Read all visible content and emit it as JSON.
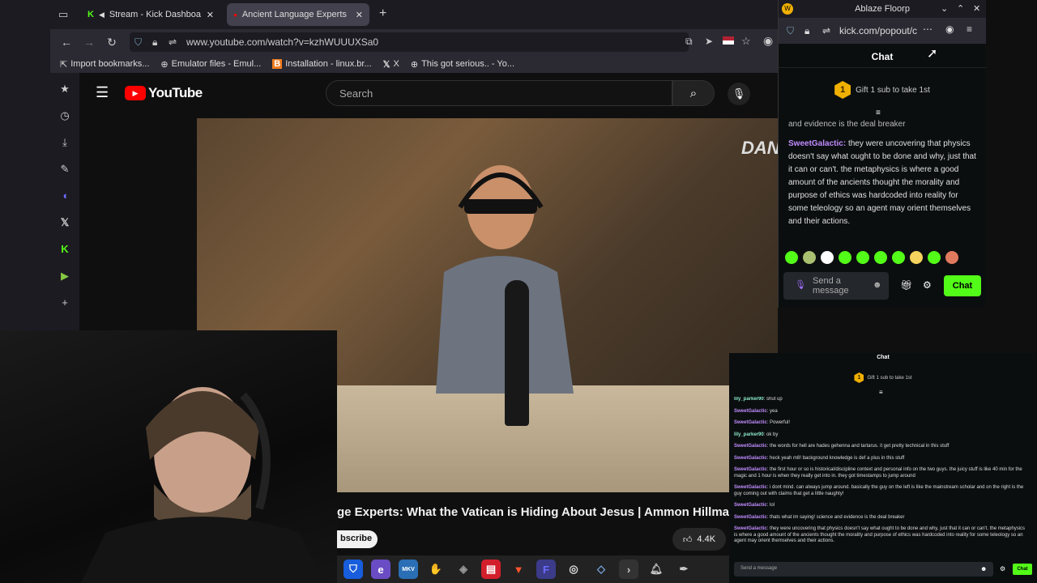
{
  "browser": {
    "tabs": [
      {
        "label": "Stream - Kick Dashboa",
        "favicon": "kick-icon"
      },
      {
        "label": "Ancient Language Experts",
        "favicon": "youtube-icon"
      }
    ],
    "url": "www.youtube.com/watch?v=kzhWUUUXSa0",
    "bookmarks": [
      {
        "label": "Import bookmarks..."
      },
      {
        "label": "Emulator files - Emul..."
      },
      {
        "label": "Installation - linux.br..."
      },
      {
        "label": "X"
      },
      {
        "label": "This got serious.. - Yo..."
      }
    ]
  },
  "youtube": {
    "logo_text": "YouTube",
    "search_placeholder": "Search",
    "video_title": "ge Experts: What the Vatican is Hiding About Jesus | Ammon Hillman",
    "subscribe_label": "bscribe",
    "like_count": "4.4K"
  },
  "popout": {
    "window_title": "Ablaze Floorp",
    "url": "kick.com/popout/c",
    "chat_label": "Chat",
    "gift_count": "1",
    "gift_text": "Gift 1 sub to take 1st",
    "partial_text": "and evidence is the deal breaker",
    "message_user": "SweetGalactic",
    "message_text": "they were uncovering that physics doesn't say what ought to be done and why, just that it can or can't. the metaphysics is where a good amount of the ancients thought the morality and purpose of ethics was hardcoded into reality for some teleology so an agent may orient themselves and their actions.",
    "input_placeholder": "Send a message",
    "send_label": "Chat"
  },
  "chat2": {
    "label": "Chat",
    "gift_text": "Gift 1 sub to take 1st",
    "gift_count": "1",
    "messages": [
      {
        "user": "lily_parker90",
        "text": "shut up",
        "color": "#8be9c8"
      },
      {
        "user": "SweetGalactic",
        "text": "yea",
        "color": "#c08cff"
      },
      {
        "user": "SweetGalactic",
        "text": "Powerful!",
        "color": "#c08cff"
      },
      {
        "user": "lily_parker90",
        "text": "ok by",
        "color": "#8be9c8"
      },
      {
        "user": "SweetGalactic",
        "text": "the words for hell are hades gehenna and tartarus. it get pretty technical in this stuff",
        "color": "#c08cff"
      },
      {
        "user": "SweetGalactic",
        "text": "heck yeah m8! background knowledge is def a plus in this stuff",
        "color": "#c08cff"
      },
      {
        "user": "SweetGalactic",
        "text": "the first hour or so is historical/discipline context and personal info on the two guys. the juicy stuff is like 40 min for the magic and 1 hour is when they really get into in. they got timestamps to jump around",
        "color": "#c08cff"
      },
      {
        "user": "SweetGalactic",
        "text": "i dont mind. can always jump around. basically the guy on the left is like the mainstream scholar and on the right is the guy coming out with claims that get a little naughty!",
        "color": "#c08cff"
      },
      {
        "user": "SweetGalactic",
        "text": "lol",
        "color": "#c08cff"
      },
      {
        "user": "SweetGalactic",
        "text": "thats what im saying! science and evidence is the deal breaker",
        "color": "#c08cff"
      },
      {
        "user": "SweetGalactic",
        "text": "they were uncovering that physics doesn't say what ought to be done and why, just that it can or can't. the metaphysics is where a good amount of the ancients thought the morality and purpose of ethics was hardcoded into reality for some teleology so an agent may orient themselves and their actions.",
        "color": "#c08cff"
      }
    ],
    "input_placeholder": "Send a message",
    "send_label": "Chat"
  },
  "colors": {
    "kick_green": "#53fc18",
    "youtube_red": "#ff0000",
    "username_purple": "#c08cff"
  }
}
